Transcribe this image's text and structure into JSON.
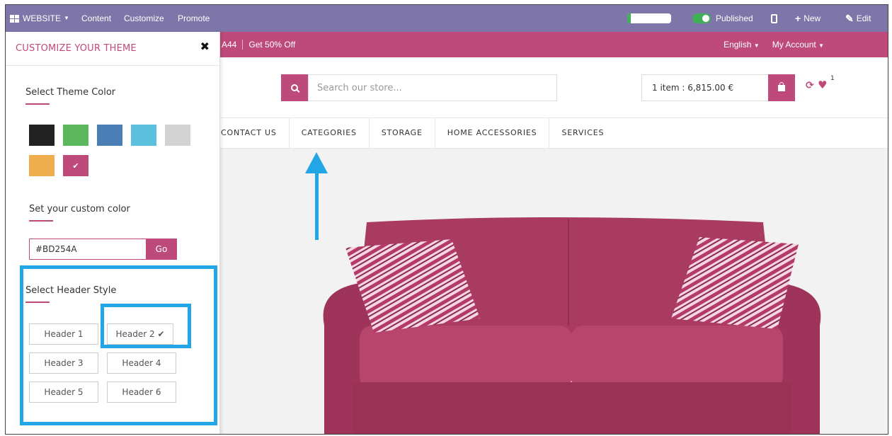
{
  "adminbar": {
    "website_label": "WEBSITE",
    "menu": [
      "Content",
      "Customize",
      "Promote"
    ],
    "progress_fraction": 0.08,
    "published_label": "Published",
    "new_label": "New",
    "edit_label": "Edit"
  },
  "promo": {
    "code_fragment": "A44",
    "offer": "Get 50% Off",
    "language": "English",
    "account": "My Account"
  },
  "header": {
    "search_placeholder": "Search our store...",
    "cart_text": "1 item : 6,815.00 €",
    "wishlist_count": "1"
  },
  "nav": {
    "items": [
      "CONTACT US",
      "CATEGORIES",
      "STORAGE",
      "HOME ACCESSORIES",
      "SERVICES"
    ]
  },
  "panel": {
    "title": "CUSTOMIZE YOUR THEME",
    "theme_color_label": "Select Theme Color",
    "swatches": [
      "#222222",
      "#5cb85c",
      "#4a7fb5",
      "#5bc0de",
      "#d3d3d3",
      "#f0ad4e",
      "#bd4a7b"
    ],
    "selected_swatch": 6,
    "check_glyph": "✔",
    "custom_color_label": "Set your custom color",
    "custom_color_value": "#BD254A",
    "go_label": "Go",
    "header_style_label": "Select Header Style",
    "header_options": [
      "Header 1",
      "Header 2 ✔",
      "Header 3",
      "Header 4",
      "Header 5",
      "Header 6"
    ]
  },
  "colors": {
    "accent": "#bd4a7b",
    "admin_bar": "#7e76a8",
    "highlight": "#23a6e6"
  }
}
